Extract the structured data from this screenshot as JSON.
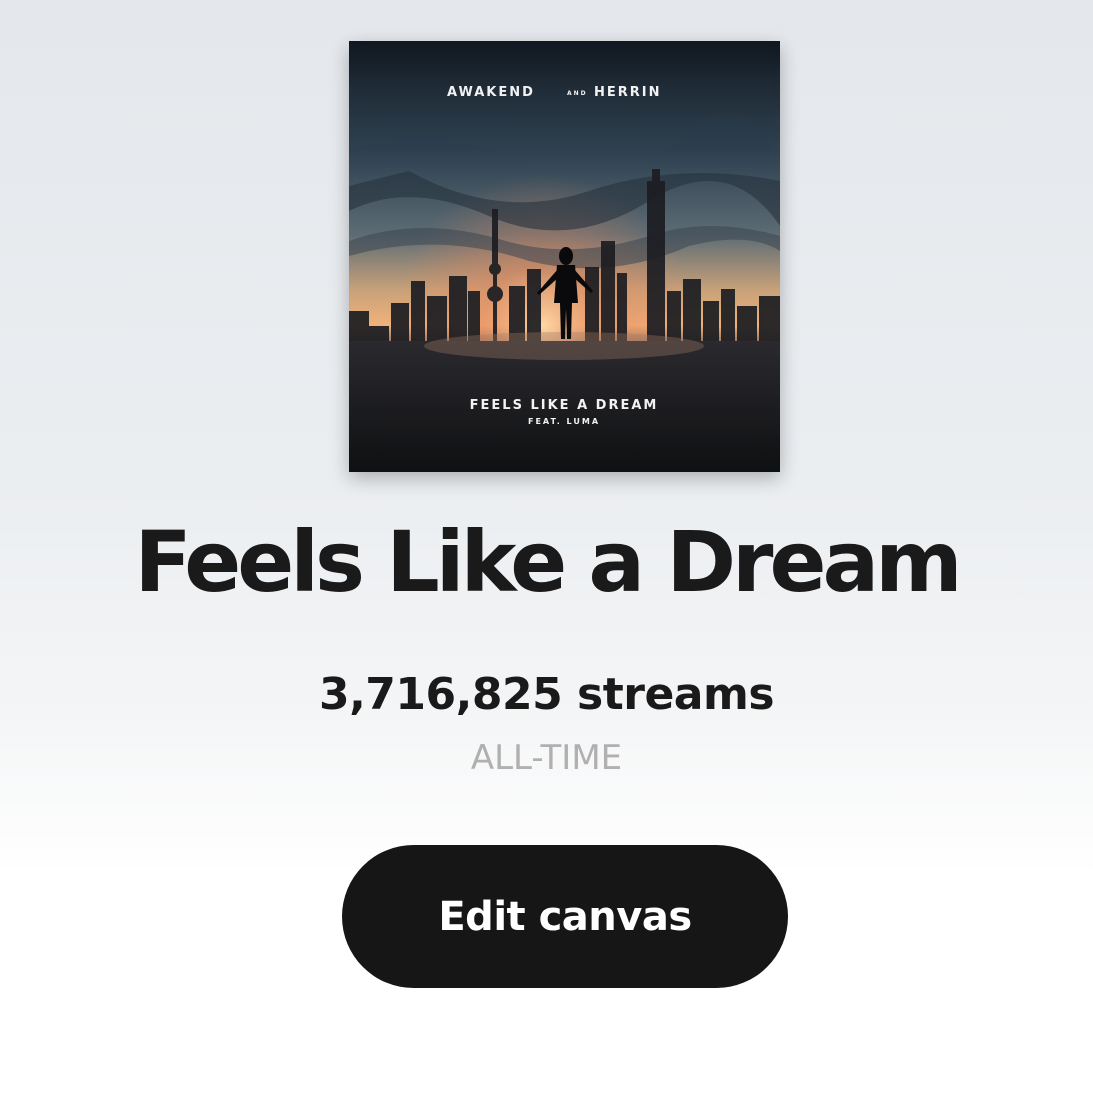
{
  "cover": {
    "artists_line_left": "AWAKEND",
    "artists_line_and": "AND",
    "artists_line_right": "HERRIN",
    "title": "FEELS LIKE A DREAM",
    "featuring": "FEAT. LUMA"
  },
  "track": {
    "title": "Feels Like a Dream",
    "streams": "3,716,825 streams",
    "period": "ALL-TIME"
  },
  "actions": {
    "edit_canvas_label": "Edit canvas"
  }
}
